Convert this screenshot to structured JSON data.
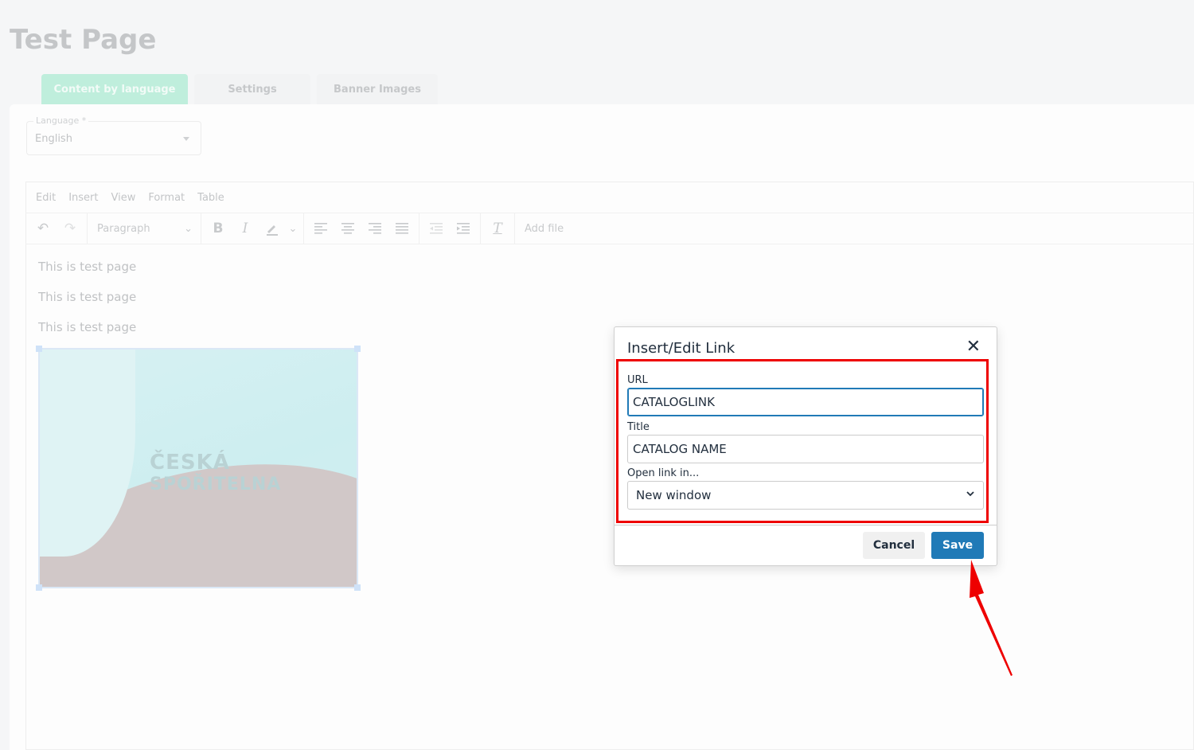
{
  "page": {
    "title": "Test Page"
  },
  "tabs": [
    {
      "label": "Content by language"
    },
    {
      "label": "Settings"
    },
    {
      "label": "Banner Images"
    }
  ],
  "language": {
    "label": "Language *",
    "value": "English"
  },
  "editor": {
    "menu": [
      "Edit",
      "Insert",
      "View",
      "Format",
      "Table"
    ],
    "block_format": "Paragraph",
    "add_file": "Add file",
    "paragraphs": [
      "This is test page",
      "This is test page",
      "This is test page"
    ],
    "image_text": [
      "ČESKÁ",
      "SPOŘITELNA"
    ]
  },
  "dialog": {
    "title": "Insert/Edit Link",
    "url_label": "URL",
    "url_value": "CATALOGLINK",
    "title_label": "Title",
    "title_value": "CATALOG NAME",
    "target_label": "Open link in...",
    "target_value": "New window",
    "cancel": "Cancel",
    "save": "Save"
  },
  "colors": {
    "accent": "#207ab7",
    "highlight": "#ee0000",
    "active_tab": "#bfeedc"
  }
}
